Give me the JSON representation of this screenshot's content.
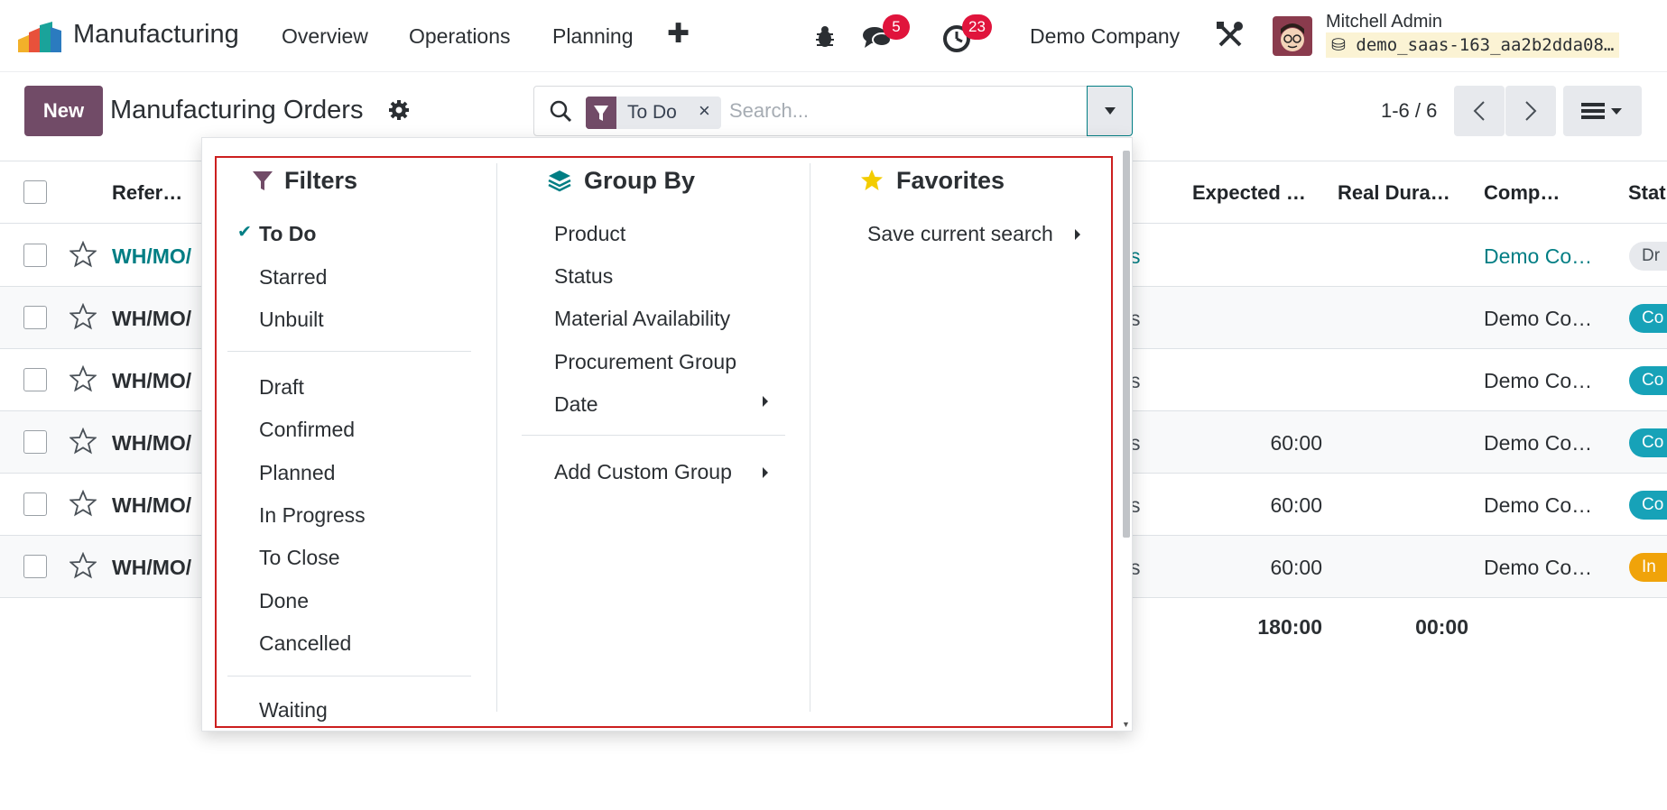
{
  "navbar": {
    "app_name": "Manufacturing",
    "menus": [
      "Overview",
      "Operations",
      "Planning"
    ],
    "add_menu_icon": "plus-icon",
    "debug_icon": "bug-icon",
    "messages_count": "5",
    "activities_count": "23",
    "company": "Demo Company",
    "settings_icon": "tools-icon",
    "user_name": "Mitchell Admin",
    "database": "demo_saas-163_aa2b2dda08…"
  },
  "control_panel": {
    "new_label": "New",
    "title": "Manufacturing Orders",
    "search": {
      "facet": "To Do",
      "placeholder": "Search..."
    },
    "pager": "1-6 / 6"
  },
  "list": {
    "headers": {
      "reference": "Refer…",
      "expected": "Expected …",
      "real_duration": "Real Dura…",
      "company": "Comp…",
      "status": "Stat"
    },
    "rows": [
      {
        "reference": "WH/MO/",
        "tail": "s",
        "expected": "",
        "company": "Demo Co…",
        "status": "Dr",
        "status_color": "#e7e9ed",
        "link": true
      },
      {
        "reference": "WH/MO/",
        "tail": "s",
        "expected": "",
        "company": "Demo Co…",
        "status": "Co",
        "status_color": "#17a2b8",
        "link": false
      },
      {
        "reference": "WH/MO/",
        "tail": "s",
        "expected": "",
        "company": "Demo Co…",
        "status": "Co",
        "status_color": "#17a2b8",
        "link": false
      },
      {
        "reference": "WH/MO/",
        "tail": "s",
        "expected": "60:00",
        "company": "Demo Co…",
        "status": "Co",
        "status_color": "#17a2b8",
        "link": false
      },
      {
        "reference": "WH/MO/",
        "tail": "s",
        "expected": "60:00",
        "company": "Demo Co…",
        "status": "Co",
        "status_color": "#17a2b8",
        "link": false
      },
      {
        "reference": "WH/MO/",
        "tail": "s",
        "expected": "60:00",
        "company": "Demo Co…",
        "status": "In",
        "status_color": "#f0a30a",
        "link": false
      }
    ],
    "totals": {
      "expected": "180:00",
      "real_duration": "00:00"
    }
  },
  "dropdown": {
    "filters": {
      "title": "Filters",
      "group1": [
        "To Do",
        "Starred",
        "Unbuilt"
      ],
      "group2": [
        "Draft",
        "Confirmed",
        "Planned",
        "In Progress",
        "To Close",
        "Done",
        "Cancelled"
      ],
      "group3": [
        "Waiting"
      ],
      "selected": "To Do"
    },
    "group_by": {
      "title": "Group By",
      "items": [
        "Product",
        "Status",
        "Material Availability",
        "Procurement Group",
        "Date"
      ],
      "custom": "Add Custom Group"
    },
    "favorites": {
      "title": "Favorites",
      "save": "Save current search"
    }
  }
}
